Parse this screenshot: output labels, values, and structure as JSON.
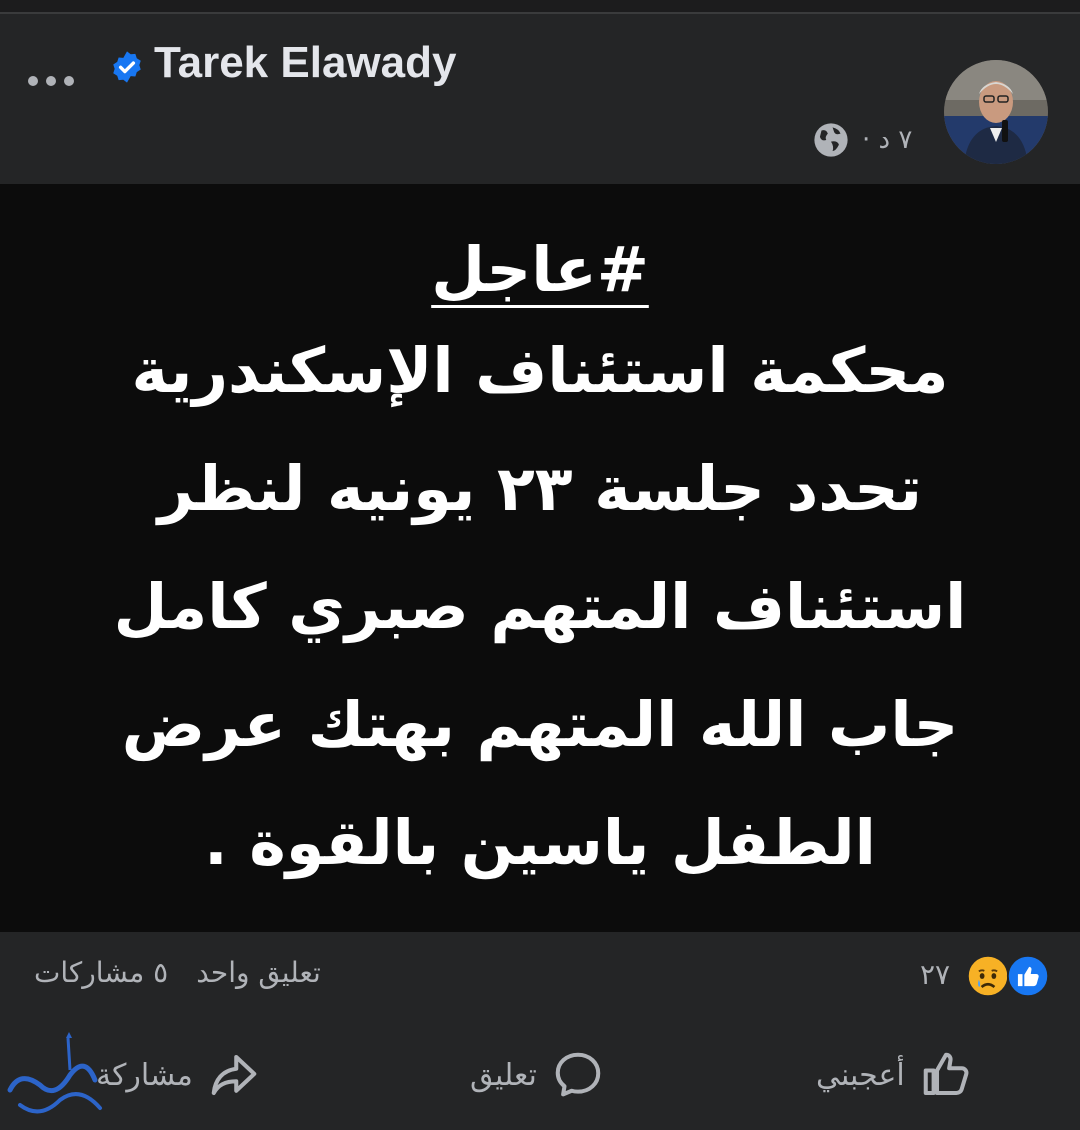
{
  "post": {
    "author": "Tarek Elawady",
    "timestamp": "٧ د ·",
    "audience_icon": "globe-icon",
    "tag": "#عاجل",
    "lines": [
      "محكمة استئناف الإسكندرية",
      "تحدد جلسة ٢٣ يونيه لنظر",
      "استئناف المتهم صبري كامل",
      "جاب الله المتهم بهتك عرض",
      "الطفل ياسين بالقوة ."
    ]
  },
  "stats": {
    "reaction_count": "٢٧",
    "comments": "تعليق واحد",
    "shares": "٥ مشاركات"
  },
  "actions": {
    "like": "أعجبني",
    "comment": "تعليق",
    "share": "مشاركة"
  },
  "colors": {
    "background": "#242526",
    "post_background": "#0c0c0c",
    "accent_blue": "#1877f2",
    "text_secondary": "#b0b3b8"
  }
}
